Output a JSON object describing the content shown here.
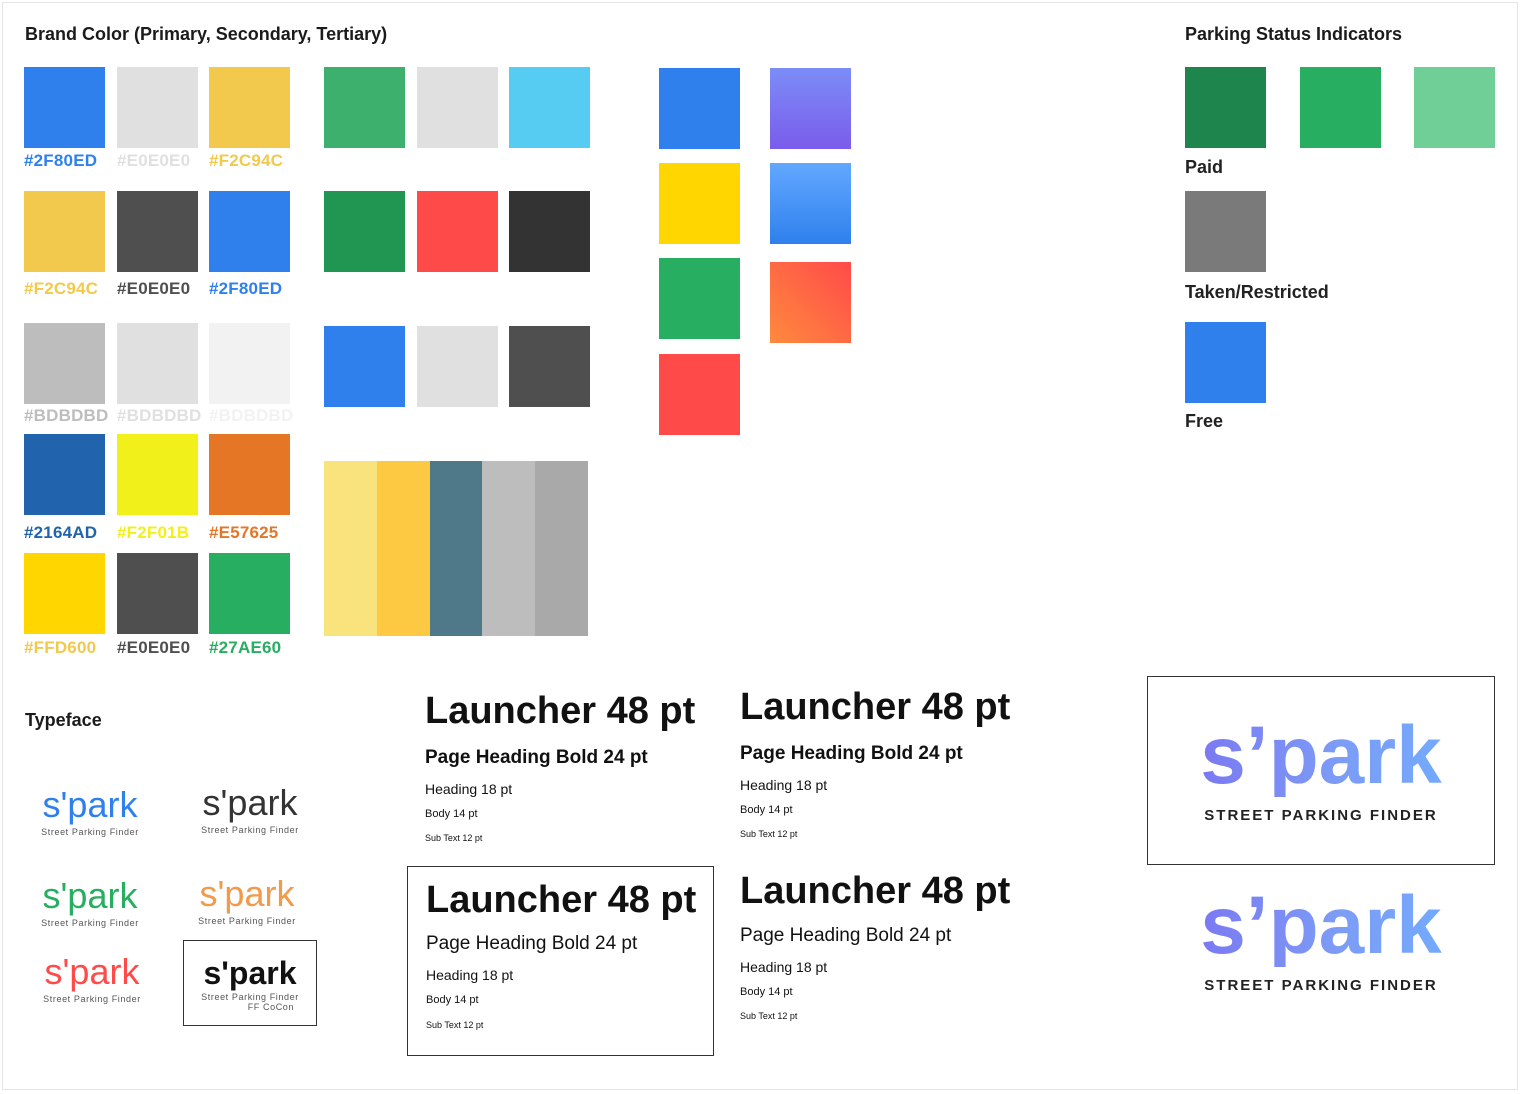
{
  "brand": {
    "title": "Brand Color (Primary, Secondary, Tertiary)",
    "rows": [
      {
        "colors": [
          "#2F80ED",
          "#E0E0E0",
          "#F2C94C"
        ],
        "labels": [
          "#2F80ED",
          "#E0E0E0",
          "#F2C94C"
        ]
      },
      {
        "colors": [
          "#F2C94C",
          "#4F4F4F",
          "#2F80ED"
        ],
        "labels": [
          "#F2C94C",
          "#E0E0E0",
          "#2F80ED"
        ]
      },
      {
        "colors": [
          "#BDBDBD",
          "#E0E0E0",
          "#F2F2F2"
        ],
        "labels": [
          "#BDBDBD",
          "#BDBDBD",
          "#BDBDBD"
        ]
      },
      {
        "colors": [
          "#2164AD",
          "#F2F01B",
          "#E57625"
        ],
        "labels": [
          "#2164AD",
          "#F2F01B",
          "#E57625"
        ]
      },
      {
        "colors": [
          "#FFD600",
          "#4F4F4F",
          "#27AE60"
        ],
        "labels": [
          "#FFD600",
          "#E0E0E0",
          "#27AE60"
        ]
      }
    ],
    "label_colors": [
      [
        "#2F80ED",
        "#E0E0E0",
        "#F2C94C"
      ],
      [
        "#F2C94C",
        "#4F4F4F",
        "#2F80ED"
      ],
      [
        "#BDBDBD",
        "#E0E0E0",
        "#F2F2F2"
      ],
      [
        "#2164AD",
        "#F2F01B",
        "#E57625"
      ],
      [
        "#F2C94C",
        "#4F4F4F",
        "#27AE60"
      ]
    ]
  },
  "palette_b": [
    [
      "#3EB06E",
      "#E0E0E0",
      "#56CCF2"
    ],
    [
      "#219653",
      "#FF4A4A",
      "#333333"
    ],
    [
      "#2F80ED",
      "#E0E0E0",
      "#4F4F4F"
    ]
  ],
  "stripe_palette": [
    "#F9E37D",
    "#FDC943",
    "#4F7889",
    "#BDBDBD",
    "#A9A9A9"
  ],
  "palette_c": {
    "solids": [
      "#2F80ED",
      "#FFD600",
      "#27AE60",
      "#FF4A4A"
    ],
    "gradients": [
      [
        "#7B8DF7",
        "#7B5CEB"
      ],
      [
        "#62A8FF",
        "#2F80ED"
      ],
      [
        "#FF8A3D",
        "#FF4A4A"
      ]
    ]
  },
  "parking": {
    "title": "Parking Status Indicators",
    "paid_colors": [
      "#1E854D",
      "#27AE60",
      "#6FCF97"
    ],
    "paid_label": "Paid",
    "taken_color": "#7A7A7A",
    "taken_label": "Taken/Restricted",
    "free_color": "#2F80ED",
    "free_label": "Free"
  },
  "typeface": {
    "title": "Typeface",
    "logos": [
      {
        "mark": "s'park",
        "tag": "Street Parking Finder",
        "color": "#2F80ED"
      },
      {
        "mark": "s'park",
        "tag": "Street Parking Finder",
        "color": "#333333"
      },
      {
        "mark": "s'park",
        "tag": "Street Parking Finder",
        "color": "#27AE60"
      },
      {
        "mark": "s'park",
        "tag": "Street Parking Finder",
        "color": "#F2994A"
      },
      {
        "mark": "s'park",
        "tag": "Street Parking Finder",
        "color": "#FF4A4A"
      },
      {
        "mark": "s'park",
        "tag": "Street Parking Finder",
        "tag2": "FF CoCon",
        "color": "#111111"
      }
    ],
    "samples": {
      "launcher": "Launcher 48 pt",
      "page_heading": "Page Heading Bold 24 pt",
      "heading": "Heading 18 pt",
      "body": "Body 14 pt",
      "subtext": "Sub Text 12 pt"
    }
  },
  "big_logo": {
    "mark": "s’park",
    "tag": "STREET PARKING FINDER"
  }
}
